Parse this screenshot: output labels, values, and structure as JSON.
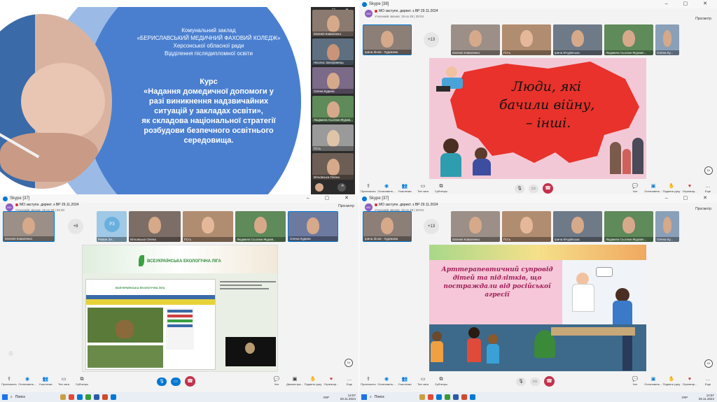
{
  "q1": {
    "org_line1": "Комунальний заклад",
    "org_line2": "«БЕРИСЛАВСЬКИЙ МЕДИЧНИЙ ФАХОВИЙ КОЛЕДЖ»",
    "org_line3": "Херсонської обласної ради",
    "org_line4": "Відділення післядипломної освіти",
    "course_title": "Курс",
    "course_line1": "«Надання домедичної допомоги у",
    "course_line2": "разі виникнення надзвичайних",
    "course_line3": "ситуацій у закладах освіти»,",
    "course_line4": "як складова національної стратегії",
    "course_line5": "розбудови безпечного освітнього",
    "course_line6": "середовища.",
    "participants": [
      "Євгенія Коваленко",
      "Ніколас Запорожець",
      "Олена Кудина",
      "Людмила Сьолюк-Журав...",
      "Гість",
      "Вітковська Олена"
    ]
  },
  "q2": {
    "app_title": "Skype [38]",
    "meeting_title": "МО заступн. директ. з ВР 29.11.2024",
    "meeting_sub": "Учасників звонка: 19 из 28 | 28:04",
    "avatar_initials": "МО",
    "self_name": "Ірина Зінов - Худякова",
    "more_count": "+13",
    "prosmotr": "Просмотр",
    "participants": [
      "Євгенія Коваленко",
      "Гість",
      "Ірина Кічурівська",
      "Людмила Сьолюк-Журавл...",
      "Олена Ку..."
    ],
    "slide_line1": "Люди, які",
    "slide_line2": "бачили війну,",
    "slide_line3": "– інші.",
    "speed": "1x",
    "controls": [
      "Пригласить",
      "Остановить...",
      "Участники",
      "Тип чата",
      "Субтитры"
    ],
    "right_controls": [
      "Чат",
      "Остановить...",
      "Поднять руку",
      "Отреагир...",
      "Еще"
    ]
  },
  "q3": {
    "app_title": "Skype [37]",
    "meeting_title": "МО заступн. директ. з ВР 29.11.2024",
    "meeting_sub": "Учасників звонка: 19 из 28 | 04:20",
    "avatar_initials": "МО",
    "self_name": "Євгенія Коваленко",
    "more_count": "+8",
    "prosmotr": "Просмотр",
    "participants": [
      "Роман Зя...",
      "Вітковська Олена",
      "Гість",
      "Людмила Сьолюк-Журав...",
      "Олена Кудина"
    ],
    "p5_initials": "РЗ",
    "site_title": "ВСЕУКРАЇНСЬКА ЕКОЛОГІЧНА ЛІГА",
    "site_inner_title": "ВСЕУКРАЇНСЬКА ЕКОЛОГІЧНА ЛІГА",
    "speed": "1x",
    "controls": [
      "Пригласить",
      "Остановить...",
      "Участники",
      "Тип чата",
      "Субтитры"
    ],
    "right_controls": [
      "Чат",
      "Демонстра...",
      "Поднять руку",
      "Отреагир...",
      "Еще"
    ],
    "search": "Поиск",
    "lang": "УКР",
    "time": "14:57",
    "date": "29.11.2024"
  },
  "q4": {
    "app_title": "Skype [37]",
    "meeting_title": "МО заступн. директ. з ВР 29.11.2024",
    "meeting_sub": "Учасників звонка: 19 из 28 | 28:04",
    "avatar_initials": "МО",
    "self_name": "Ірина Зінов - Худякова",
    "more_count": "+13",
    "prosmotr": "Просмотр",
    "participants": [
      "Євгенія Коваленко",
      "Гість",
      "Ірина Кічурівська",
      "Людмила Сьолюк-Журавл...",
      "Олена Ку..."
    ],
    "slide_line1": "Арттерапевтичний супровід",
    "slide_line2": "дітей та підлітків, що",
    "slide_line3": "постраждали від російської",
    "slide_line4": "агресії",
    "speed": "1x",
    "controls": [
      "Пригласить",
      "Остановить...",
      "Участники",
      "Тип чата",
      "Субтитры"
    ],
    "right_controls": [
      "Чат",
      "Остановить...",
      "Поднять руку",
      "Отреагир...",
      "Еще"
    ],
    "search": "Поиск",
    "lang": "УКР",
    "time": "14:57",
    "date": "29.11.2024"
  },
  "colors": {
    "slide_blue": "#4a7fd0",
    "skype_blue": "#0078d4",
    "end_red": "#c4314b",
    "map_red": "#e8322b",
    "art_pink": "#f6c7d8"
  }
}
